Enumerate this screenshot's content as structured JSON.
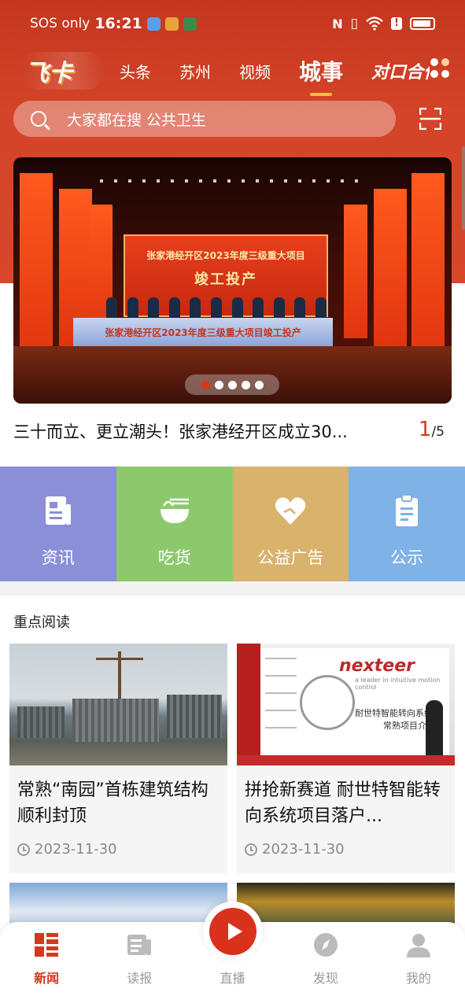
{
  "status_bar": {
    "carrier": "SOS only",
    "time": "16:21",
    "apps": [
      {
        "icon": "weather-app-icon",
        "color": "#5aa0e8"
      },
      {
        "icon": "news-app-icon",
        "color": "#e8a43a"
      },
      {
        "icon": "game-app-icon",
        "color": "#3a8c4a"
      }
    ],
    "icons": [
      "nfc-icon",
      "vibrate-icon",
      "wifi-icon",
      "alert-icon",
      "battery-icon"
    ]
  },
  "header": {
    "logo_text": "飞卡",
    "tabs": [
      {
        "label": "头条"
      },
      {
        "label": "苏州"
      },
      {
        "label": "视频"
      },
      {
        "label": "城事",
        "active": true
      }
    ],
    "special_tab": "对口合作",
    "search_placeholder": "大家都在搜 公共卫生"
  },
  "banner": {
    "screen_line1": "张家港经开区2023年度三级重大项目",
    "screen_line2": "竣工投产",
    "front_banner": "张家港经开区2023年度三级重大项目竣工投产",
    "dots": 5,
    "active_dot": 0,
    "caption": "三十而立、更立潮头！张家港经开区成立30...",
    "counter_current": "1",
    "counter_total": "/5"
  },
  "categories": [
    {
      "label": "资讯",
      "color": "#8b8fd8",
      "icon": "news-doc-icon"
    },
    {
      "label": "吃货",
      "color": "#8cc96d",
      "icon": "noodle-bowl-icon"
    },
    {
      "label": "公益广告",
      "color": "#d9b26b",
      "icon": "heart-hands-icon"
    },
    {
      "label": "公示",
      "color": "#7fb2e6",
      "icon": "clipboard-icon"
    }
  ],
  "featured": {
    "title": "重点阅读",
    "cards": [
      {
        "title": "常熟“南园”首栋建筑结构顺利封顶",
        "date": "2023-11-30"
      },
      {
        "title": "拼抢新赛道 耐世特智能转向系统项目落户...",
        "date": "2023-11-30",
        "brand": "nexteer",
        "brand_sub": "a leader in intuitive motion control",
        "zh1": "耐世特智能转向系统",
        "zh2": "常熟项目介绍"
      }
    ]
  },
  "bottom_nav": {
    "items": [
      {
        "label": "新闻",
        "icon": "news-grid-icon",
        "active": true
      },
      {
        "label": "读报",
        "icon": "newspaper-icon"
      },
      {
        "label": "直播",
        "icon": "play-icon"
      },
      {
        "label": "发现",
        "icon": "compass-icon"
      },
      {
        "label": "我的",
        "icon": "profile-icon"
      }
    ]
  },
  "colors": {
    "brand_red": "#d4381e",
    "header_bg": "#c4361f"
  }
}
